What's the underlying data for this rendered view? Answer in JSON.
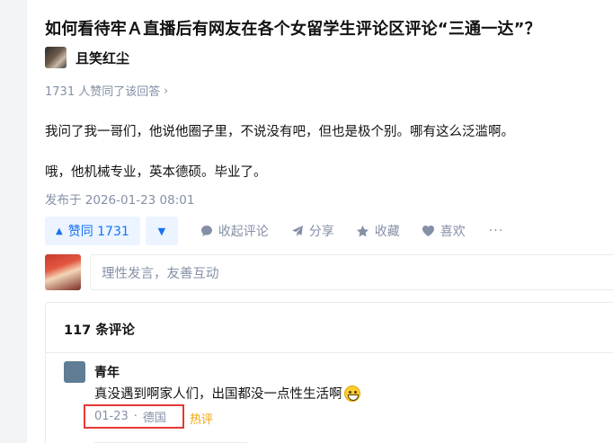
{
  "question": {
    "title": "如何看待牢Ａ直播后有网友在各个女留学生评论区评论“三通一达”？"
  },
  "author": {
    "name": "且笑红尘"
  },
  "answer": {
    "upvote_summary": "1731 人赞同了该回答",
    "paragraphs": [
      "我问了我一哥们，他说他圈子里，不说没有吧，但也是极个别。哪有这么泛滥啊。",
      "哦，他机械专业，英本德硕。毕业了。"
    ],
    "published": "发布于 2026-01-23 08:01"
  },
  "actions": {
    "upvote_label": "赞同 1731",
    "collapse_comments": "收起评论",
    "share": "分享",
    "favorite": "收藏",
    "like": "喜欢",
    "more": "···"
  },
  "composer": {
    "placeholder": "理性发言，友善互动"
  },
  "comments": {
    "count_label": "117 条评论",
    "items": [
      {
        "name": "青年",
        "text": "真没遇到啊家人们，出国都没一点性生活啊",
        "date": "01-23",
        "separator": "·",
        "location": "德国",
        "tag": "热评"
      }
    ]
  },
  "colors": {
    "accent": "#1772f6",
    "muted": "#8590a6",
    "hot": "#f1a205",
    "highlight_box": "#e53935"
  },
  "icons": {
    "upvote": "triangle-up-icon",
    "downvote": "triangle-down-icon",
    "comment": "comment-bubble-icon",
    "share": "paper-plane-icon",
    "favorite": "star-icon",
    "like": "heart-icon",
    "emoji": "grinning-face-icon"
  }
}
